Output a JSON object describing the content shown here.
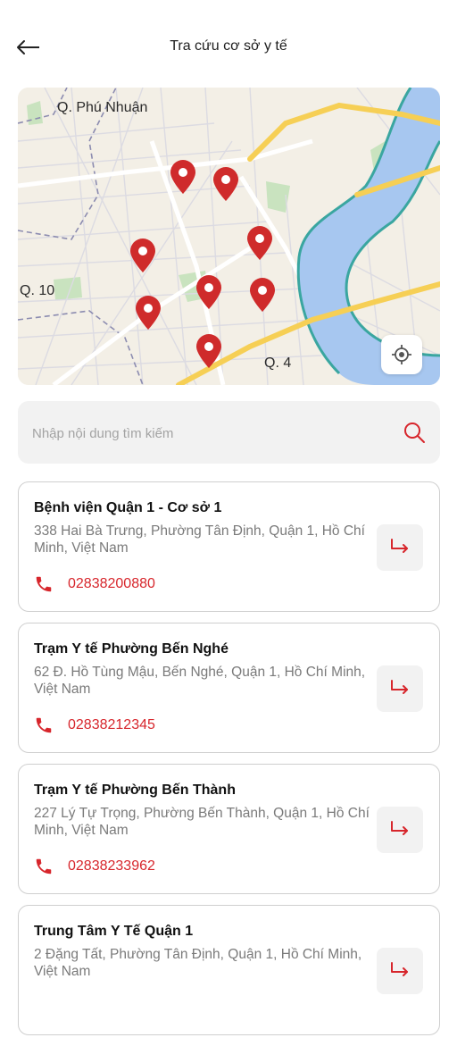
{
  "header": {
    "title": "Tra cứu cơ sở y tế",
    "back_icon": "arrow-left-icon"
  },
  "map": {
    "labels": {
      "phu_nhuan": "Q. Phú Nhuận",
      "q10": "Q. 10",
      "q4": "Q. 4"
    },
    "pin_color": "#cf2b2b",
    "pin_count": 8,
    "locate_icon": "locate-icon"
  },
  "search": {
    "placeholder": "Nhập nội dung tìm kiếm",
    "value": "",
    "icon": "search-icon"
  },
  "colors": {
    "accent": "#d7262c",
    "secondary_text": "#7a7a7a",
    "card_border": "#cfcfcf"
  },
  "facilities": [
    {
      "name": "Bệnh viện Quận 1 - Cơ sở 1",
      "address": "338 Hai Bà Trưng, Phường Tân Định, Quận 1, Hồ Chí Minh, Việt Nam",
      "phone": "02838200880"
    },
    {
      "name": "Trạm Y tế Phường Bến Nghé",
      "address": "62 Đ. Hồ Tùng Mậu, Bến Nghé, Quận 1, Hồ Chí Minh, Việt Nam",
      "phone": "02838212345"
    },
    {
      "name": "Trạm Y tế Phường Bến Thành",
      "address": "227 Lý Tự Trọng, Phường Bến Thành, Quận 1, Hồ Chí Minh, Việt Nam",
      "phone": "02838233962"
    },
    {
      "name": "Trung Tâm Y Tế Quận 1",
      "address": "2 Đặng Tất, Phường Tân Định, Quận 1, Hồ Chí Minh, Việt Nam",
      "phone": ""
    }
  ]
}
